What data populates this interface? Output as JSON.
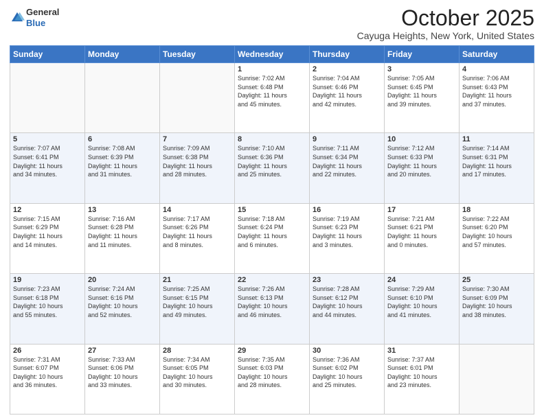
{
  "logo": {
    "general": "General",
    "blue": "Blue"
  },
  "title": "October 2025",
  "location": "Cayuga Heights, New York, United States",
  "days_of_week": [
    "Sunday",
    "Monday",
    "Tuesday",
    "Wednesday",
    "Thursday",
    "Friday",
    "Saturday"
  ],
  "weeks": [
    [
      {
        "day": "",
        "info": ""
      },
      {
        "day": "",
        "info": ""
      },
      {
        "day": "",
        "info": ""
      },
      {
        "day": "1",
        "info": "Sunrise: 7:02 AM\nSunset: 6:48 PM\nDaylight: 11 hours\nand 45 minutes."
      },
      {
        "day": "2",
        "info": "Sunrise: 7:04 AM\nSunset: 6:46 PM\nDaylight: 11 hours\nand 42 minutes."
      },
      {
        "day": "3",
        "info": "Sunrise: 7:05 AM\nSunset: 6:45 PM\nDaylight: 11 hours\nand 39 minutes."
      },
      {
        "day": "4",
        "info": "Sunrise: 7:06 AM\nSunset: 6:43 PM\nDaylight: 11 hours\nand 37 minutes."
      }
    ],
    [
      {
        "day": "5",
        "info": "Sunrise: 7:07 AM\nSunset: 6:41 PM\nDaylight: 11 hours\nand 34 minutes."
      },
      {
        "day": "6",
        "info": "Sunrise: 7:08 AM\nSunset: 6:39 PM\nDaylight: 11 hours\nand 31 minutes."
      },
      {
        "day": "7",
        "info": "Sunrise: 7:09 AM\nSunset: 6:38 PM\nDaylight: 11 hours\nand 28 minutes."
      },
      {
        "day": "8",
        "info": "Sunrise: 7:10 AM\nSunset: 6:36 PM\nDaylight: 11 hours\nand 25 minutes."
      },
      {
        "day": "9",
        "info": "Sunrise: 7:11 AM\nSunset: 6:34 PM\nDaylight: 11 hours\nand 22 minutes."
      },
      {
        "day": "10",
        "info": "Sunrise: 7:12 AM\nSunset: 6:33 PM\nDaylight: 11 hours\nand 20 minutes."
      },
      {
        "day": "11",
        "info": "Sunrise: 7:14 AM\nSunset: 6:31 PM\nDaylight: 11 hours\nand 17 minutes."
      }
    ],
    [
      {
        "day": "12",
        "info": "Sunrise: 7:15 AM\nSunset: 6:29 PM\nDaylight: 11 hours\nand 14 minutes."
      },
      {
        "day": "13",
        "info": "Sunrise: 7:16 AM\nSunset: 6:28 PM\nDaylight: 11 hours\nand 11 minutes."
      },
      {
        "day": "14",
        "info": "Sunrise: 7:17 AM\nSunset: 6:26 PM\nDaylight: 11 hours\nand 8 minutes."
      },
      {
        "day": "15",
        "info": "Sunrise: 7:18 AM\nSunset: 6:24 PM\nDaylight: 11 hours\nand 6 minutes."
      },
      {
        "day": "16",
        "info": "Sunrise: 7:19 AM\nSunset: 6:23 PM\nDaylight: 11 hours\nand 3 minutes."
      },
      {
        "day": "17",
        "info": "Sunrise: 7:21 AM\nSunset: 6:21 PM\nDaylight: 11 hours\nand 0 minutes."
      },
      {
        "day": "18",
        "info": "Sunrise: 7:22 AM\nSunset: 6:20 PM\nDaylight: 10 hours\nand 57 minutes."
      }
    ],
    [
      {
        "day": "19",
        "info": "Sunrise: 7:23 AM\nSunset: 6:18 PM\nDaylight: 10 hours\nand 55 minutes."
      },
      {
        "day": "20",
        "info": "Sunrise: 7:24 AM\nSunset: 6:16 PM\nDaylight: 10 hours\nand 52 minutes."
      },
      {
        "day": "21",
        "info": "Sunrise: 7:25 AM\nSunset: 6:15 PM\nDaylight: 10 hours\nand 49 minutes."
      },
      {
        "day": "22",
        "info": "Sunrise: 7:26 AM\nSunset: 6:13 PM\nDaylight: 10 hours\nand 46 minutes."
      },
      {
        "day": "23",
        "info": "Sunrise: 7:28 AM\nSunset: 6:12 PM\nDaylight: 10 hours\nand 44 minutes."
      },
      {
        "day": "24",
        "info": "Sunrise: 7:29 AM\nSunset: 6:10 PM\nDaylight: 10 hours\nand 41 minutes."
      },
      {
        "day": "25",
        "info": "Sunrise: 7:30 AM\nSunset: 6:09 PM\nDaylight: 10 hours\nand 38 minutes."
      }
    ],
    [
      {
        "day": "26",
        "info": "Sunrise: 7:31 AM\nSunset: 6:07 PM\nDaylight: 10 hours\nand 36 minutes."
      },
      {
        "day": "27",
        "info": "Sunrise: 7:33 AM\nSunset: 6:06 PM\nDaylight: 10 hours\nand 33 minutes."
      },
      {
        "day": "28",
        "info": "Sunrise: 7:34 AM\nSunset: 6:05 PM\nDaylight: 10 hours\nand 30 minutes."
      },
      {
        "day": "29",
        "info": "Sunrise: 7:35 AM\nSunset: 6:03 PM\nDaylight: 10 hours\nand 28 minutes."
      },
      {
        "day": "30",
        "info": "Sunrise: 7:36 AM\nSunset: 6:02 PM\nDaylight: 10 hours\nand 25 minutes."
      },
      {
        "day": "31",
        "info": "Sunrise: 7:37 AM\nSunset: 6:01 PM\nDaylight: 10 hours\nand 23 minutes."
      },
      {
        "day": "",
        "info": ""
      }
    ]
  ]
}
